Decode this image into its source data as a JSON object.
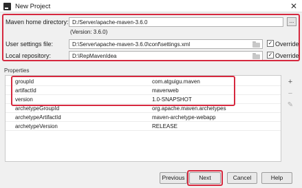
{
  "window": {
    "title": "New Project"
  },
  "maven": {
    "home_label": "Maven home directory:",
    "home_value": "D:/Server/apache-maven-3.6.0",
    "browse_label": "...",
    "version_text": "(Version: 3.6.0)",
    "settings_label": "User settings file:",
    "settings_value": "D:\\Server\\apache-maven-3.6.0\\conf\\settings.xml",
    "repo_label": "Local repository:",
    "repo_value": "D:\\RepMavenIdea",
    "override_label": "Override",
    "settings_override_checked": true,
    "repo_override_checked": true
  },
  "properties": {
    "section_label": "Properties",
    "rows": [
      {
        "key": "groupId",
        "value": "com.atguigu.maven"
      },
      {
        "key": "artifactId",
        "value": "mavenweb"
      },
      {
        "key": "version",
        "value": "1.0-SNAPSHOT"
      },
      {
        "key": "archetypeGroupId",
        "value": "org.apache.maven.archetypes"
      },
      {
        "key": "archetypeArtifactId",
        "value": "maven-archetype-webapp"
      },
      {
        "key": "archetypeVersion",
        "value": "RELEASE"
      }
    ],
    "toolbar": {
      "add": "+",
      "remove": "−",
      "edit": "✎"
    }
  },
  "buttons": {
    "previous": "Previous",
    "next": "Next",
    "cancel": "Cancel",
    "help": "Help"
  },
  "colors": {
    "highlight": "#d6283e"
  }
}
